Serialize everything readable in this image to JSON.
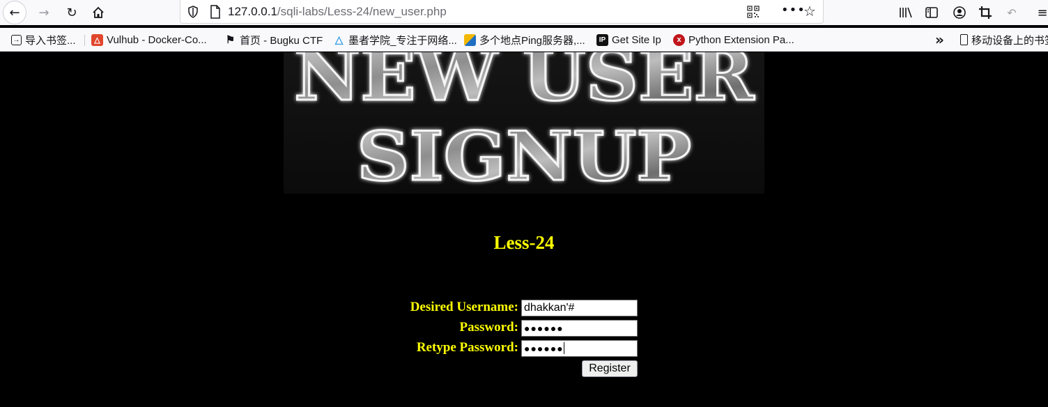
{
  "browser": {
    "url_host": "127.0.0.1",
    "url_path": "/sqli-labs/Less-24/new_user.php"
  },
  "bookmarks": [
    {
      "label": "导入书签...",
      "icon": "import-icon"
    },
    {
      "label": "Vulhub - Docker-Co...",
      "icon": "vulhub-icon",
      "color": "#e0462c"
    },
    {
      "label": "首页 - Bugku CTF",
      "icon": "flag-icon"
    },
    {
      "label": "墨者学院_专注于网络...",
      "icon": "mozhe-icon",
      "color": "#3aa0e6"
    },
    {
      "label": "多个地点Ping服务器,...",
      "icon": "ping-icon",
      "color": "#1f6fc2"
    },
    {
      "label": "Get Site Ip",
      "icon": "ip-icon",
      "color": "#111111"
    },
    {
      "label": "Python Extension Pa...",
      "icon": "python-ext-icon",
      "color": "#c0151b"
    },
    {
      "label": "移动设备上的书签",
      "icon": "mobile-icon"
    }
  ],
  "banner": {
    "line1": "NEW USER",
    "line2": "SIGNUP"
  },
  "page": {
    "lesson_title": "Less-24"
  },
  "form": {
    "username_label": "Desired Username:",
    "username_value": "dhakkan'#",
    "password_label": "Password:",
    "password_value": "●●●●●●",
    "retype_label": "Retype Password:",
    "retype_value": "●●●●●●",
    "register_label": "Register"
  },
  "colors": {
    "accent_text": "#ffff00",
    "page_background": "#000000"
  }
}
